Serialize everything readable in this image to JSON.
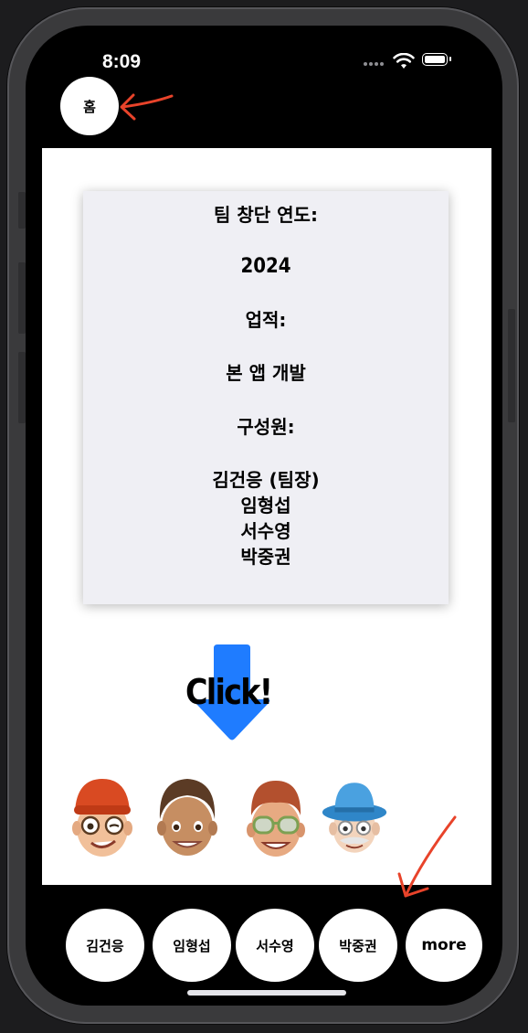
{
  "status_bar": {
    "time": "8:09"
  },
  "header": {
    "home_button": "홈"
  },
  "info": {
    "founded_label": "팀 창단 연도:",
    "founded_year": "2024",
    "achievements_label": "업적:",
    "achievements_value": "본 앱 개발",
    "members_label": "구성원:",
    "members": [
      "김건응 (팀장)",
      "임형섭",
      "서수영",
      "박중권"
    ]
  },
  "click_button": {
    "label": "Click!",
    "arrow_color": "#1f7cff"
  },
  "avatars": [
    {
      "icon": "memoji-red-beanie-icon"
    },
    {
      "icon": "memoji-brown-hair-icon"
    },
    {
      "icon": "memoji-green-glasses-icon"
    },
    {
      "icon": "memoji-blue-hat-icon"
    }
  ],
  "tab_bar": {
    "items": [
      "김건응",
      "임형섭",
      "서수영",
      "박중권",
      "more"
    ]
  },
  "colors": {
    "annotation_arrow": "#e8432a",
    "screen_bg": "#000000",
    "content_bg": "#ffffff",
    "card_bg": "#efeff4"
  }
}
